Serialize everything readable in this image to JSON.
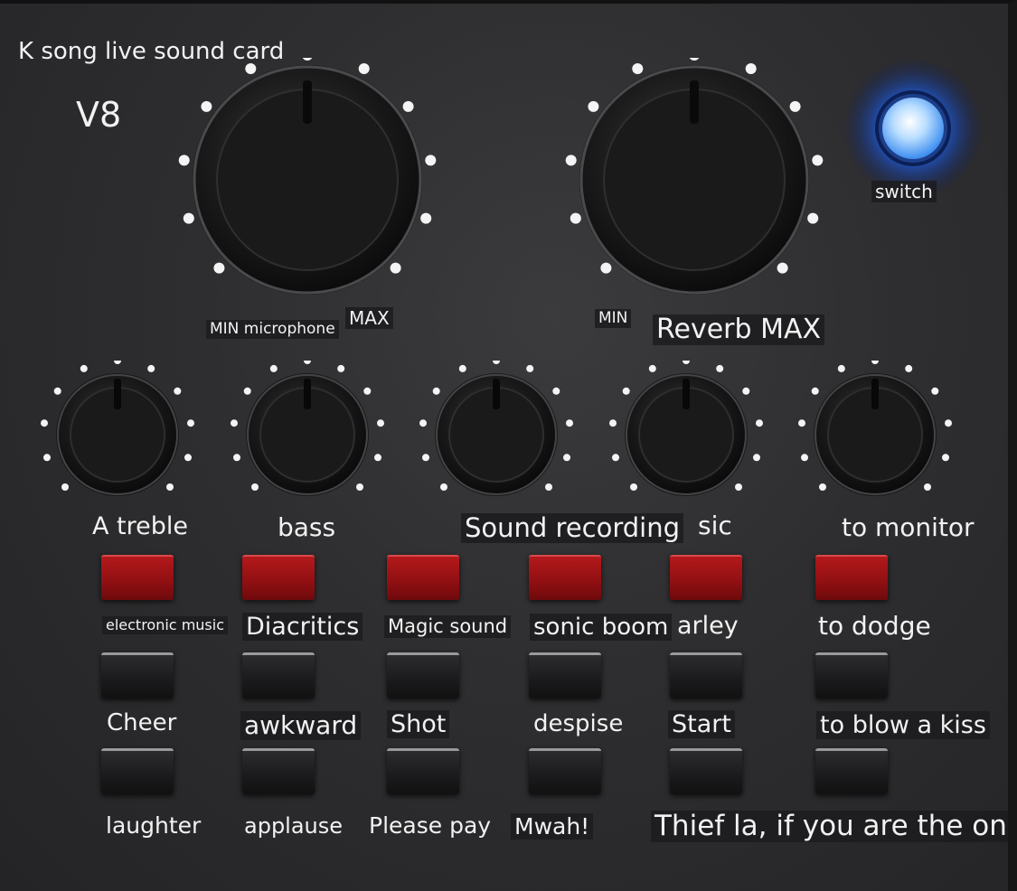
{
  "title": "K song live sound card",
  "model": "V8",
  "power": {
    "label": "switch",
    "color": "#3a8bff"
  },
  "big_knobs": {
    "mic_min_label": "MIN microphone",
    "mic_max_label": "MAX",
    "reverb_min_label": "MIN",
    "reverb_max_label": "Reverb MAX"
  },
  "small_knobs": [
    "A treble",
    "bass",
    "Sound recording",
    "sic",
    "to monitor"
  ],
  "red_row_labels": [
    "electronic music",
    "Diacritics",
    "Magic sound",
    "sonic boom",
    "arley",
    "to dodge"
  ],
  "row2_labels": [
    "Cheer",
    "awkward",
    "Shot",
    "despise",
    "Start",
    "to blow a kiss"
  ],
  "row3_labels": [
    "laughter",
    "applause",
    "Please pay",
    "Mwah!",
    "Thief la, if you are the on"
  ],
  "colors": {
    "red_button": "#a81518",
    "black_button": "#1c1c1e",
    "panel": "#2e2e30"
  }
}
